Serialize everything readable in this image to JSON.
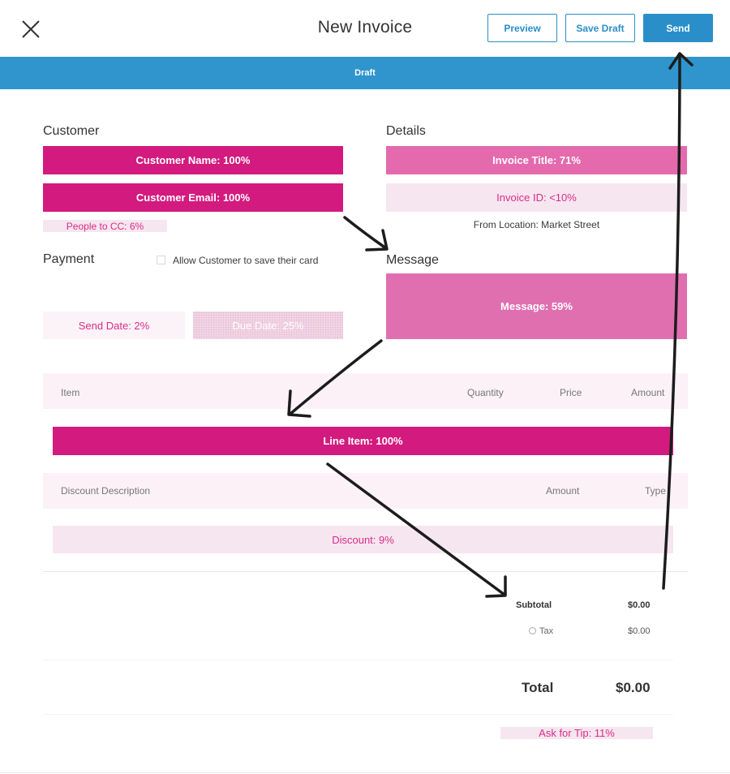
{
  "header": {
    "title": "New Invoice",
    "preview_label": "Preview",
    "save_draft_label": "Save Draft",
    "send_label": "Send"
  },
  "status_bar": {
    "label": "Draft"
  },
  "customer": {
    "heading": "Customer",
    "name_field": "Customer Name: 100%",
    "email_field": "Customer Email: 100%",
    "cc_field": "People to CC: 6%"
  },
  "details": {
    "heading": "Details",
    "invoice_title": "Invoice Title: 71%",
    "invoice_id": "Invoice ID: <10%",
    "from_location": "From Location: Market Street"
  },
  "payment": {
    "heading": "Payment",
    "save_card_label": "Allow Customer to save their card",
    "send_date": "Send Date: 2%",
    "due_date": "Due Date: 25%"
  },
  "message": {
    "heading": "Message",
    "field": "Message: 59%"
  },
  "items_table": {
    "columns": [
      "Item",
      "Quantity",
      "Price",
      "Amount"
    ],
    "line_item": "Line Item: 100%"
  },
  "discount_table": {
    "columns": [
      "Discount Description",
      "Amount",
      "Type"
    ],
    "discount": "Discount: 9%"
  },
  "totals": {
    "subtotal_label": "Subtotal",
    "subtotal_value": "$0.00",
    "tax_label": "Tax",
    "tax_value": "$0.00",
    "total_label": "Total",
    "total_value": "$0.00",
    "tip": "Ask for Tip: 11%"
  },
  "colors": {
    "accent": "#2a8fc9",
    "heat_strong": "#d31a7e",
    "heat_mid": "#e06fb0",
    "heat_light": "#f6e6ef"
  }
}
